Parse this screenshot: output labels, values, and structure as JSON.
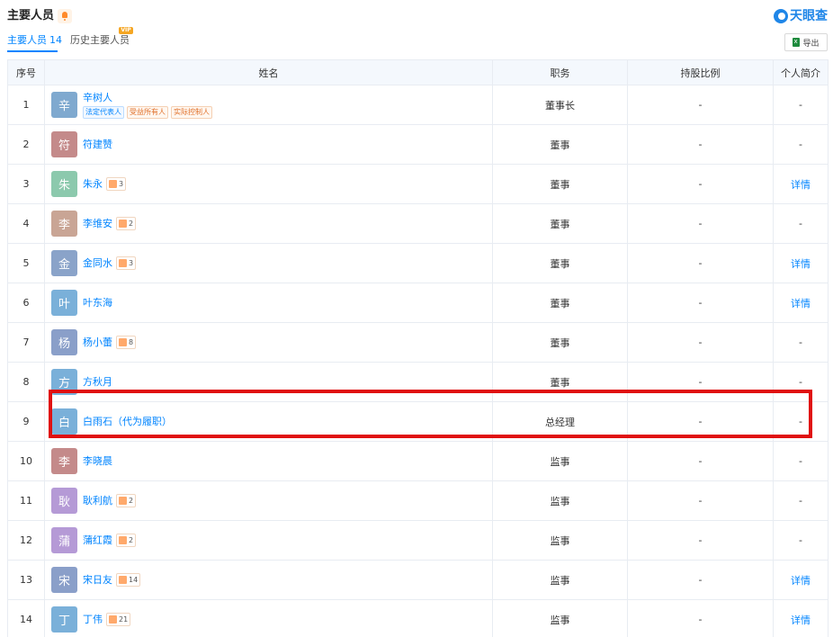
{
  "header": {
    "title": "主要人员",
    "bell_icon": "bell-icon"
  },
  "brand": {
    "name": "天眼查",
    "color": "#1f86e8"
  },
  "tabs": [
    {
      "label": "主要人员",
      "count": "14",
      "active": true
    },
    {
      "label": "历史主要人员",
      "active": false,
      "badge": "VIP"
    }
  ],
  "export": {
    "label": "导出"
  },
  "table": {
    "columns": [
      "序号",
      "姓名",
      "职务",
      "持股比例",
      "个人简介"
    ],
    "rows": [
      {
        "seq": "1",
        "avatar": "辛",
        "avatar_color": "#7fa9cf",
        "name": "辛树人",
        "role": "董事长",
        "share": "-",
        "bio": "-",
        "tags": [
          "法定代表人",
          "受益所有人",
          "实际控制人"
        ]
      },
      {
        "seq": "2",
        "avatar": "符",
        "avatar_color": "#c48a8a",
        "name": "符建赞",
        "role": "董事",
        "share": "-",
        "bio": "-"
      },
      {
        "seq": "3",
        "avatar": "朱",
        "avatar_color": "#8cc9ad",
        "name": "朱永",
        "rel": "3",
        "role": "董事",
        "share": "-",
        "bio": "详情"
      },
      {
        "seq": "4",
        "avatar": "李",
        "avatar_color": "#c9a595",
        "name": "李维安",
        "rel": "2",
        "role": "董事",
        "share": "-",
        "bio": "-"
      },
      {
        "seq": "5",
        "avatar": "金",
        "avatar_color": "#8aa3c9",
        "name": "金同水",
        "rel": "3",
        "role": "董事",
        "share": "-",
        "bio": "详情"
      },
      {
        "seq": "6",
        "avatar": "叶",
        "avatar_color": "#7ab0d9",
        "name": "叶东海",
        "role": "董事",
        "share": "-",
        "bio": "详情"
      },
      {
        "seq": "7",
        "avatar": "杨",
        "avatar_color": "#8a9fc9",
        "name": "杨小蕾",
        "rel": "8",
        "role": "董事",
        "share": "-",
        "bio": "-"
      },
      {
        "seq": "8",
        "avatar": "方",
        "avatar_color": "#7ab0d9",
        "name": "方秋月",
        "role": "董事",
        "share": "-",
        "bio": "-"
      },
      {
        "seq": "9",
        "avatar": "白",
        "avatar_color": "#7ab0d9",
        "name": "白雨石（代为履职）",
        "role": "总经理",
        "share": "-",
        "bio": "-"
      },
      {
        "seq": "10",
        "avatar": "李",
        "avatar_color": "#c48a8a",
        "name": "李晓晨",
        "role": "监事",
        "share": "-",
        "bio": "-"
      },
      {
        "seq": "11",
        "avatar": "耿",
        "avatar_color": "#b59ad6",
        "name": "耿利航",
        "rel": "2",
        "role": "监事",
        "share": "-",
        "bio": "-"
      },
      {
        "seq": "12",
        "avatar": "蒲",
        "avatar_color": "#b59ad6",
        "name": "蒲红霞",
        "rel": "2",
        "role": "监事",
        "share": "-",
        "bio": "-"
      },
      {
        "seq": "13",
        "avatar": "宋",
        "avatar_color": "#8a9fc9",
        "name": "宋日友",
        "rel": "14",
        "role": "监事",
        "share": "-",
        "bio": "详情"
      },
      {
        "seq": "14",
        "avatar": "丁",
        "avatar_color": "#7ab0d9",
        "name": "丁伟",
        "rel": "21",
        "role": "监事",
        "share": "-",
        "bio": "详情"
      }
    ]
  },
  "highlight": {
    "row_seq": "9",
    "color": "#e01010"
  }
}
